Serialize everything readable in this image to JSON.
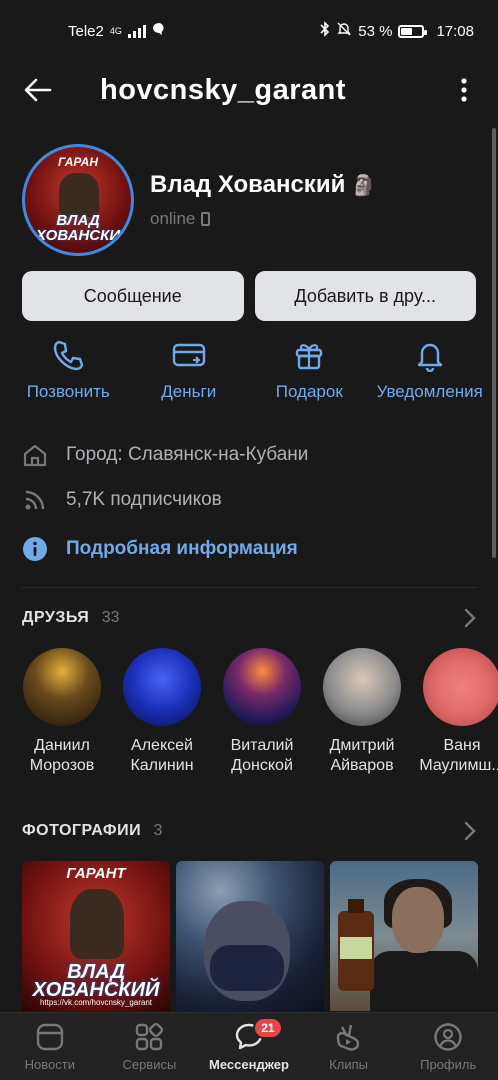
{
  "status_bar": {
    "carrier": "Tele2",
    "network": "4G",
    "battery_percent": "53 %",
    "battery_level": 0.53,
    "time": "17:08"
  },
  "appbar": {
    "title": "hovcnsky_garant",
    "back_icon": "arrow-left-icon",
    "more_icon": "more-vertical-icon"
  },
  "profile": {
    "name": "Влад Хованский",
    "emoji": "🗿",
    "status": "online",
    "avatar_text_top": "ГАРАН",
    "avatar_text_name": "ВЛАД ХОВАНСКИ"
  },
  "buttons": {
    "message": "Сообщение",
    "add_friend": "Добавить в дру..."
  },
  "actions": [
    {
      "label": "Позвонить",
      "icon": "phone-icon"
    },
    {
      "label": "Деньги",
      "icon": "money-icon"
    },
    {
      "label": "Подарок",
      "icon": "gift-icon"
    },
    {
      "label": "Уведомления",
      "icon": "bell-icon"
    }
  ],
  "info": {
    "city": "Город: Славянск-на-Кубани",
    "followers": "5,7K подписчиков",
    "details": "Подробная информация"
  },
  "friends_section": {
    "title": "ДРУЗЬЯ",
    "count": "33",
    "friends": [
      {
        "first": "Даниил",
        "last": "Морозов",
        "color": "#6b4a1c"
      },
      {
        "first": "Алексей",
        "last": "Калинин",
        "color": "#1b2fb8"
      },
      {
        "first": "Виталий",
        "last": "Донской",
        "color": "#241a58"
      },
      {
        "first": "Дмитрий",
        "last": "Айваров",
        "color": "#8c8c8c"
      },
      {
        "first": "Ваня",
        "last": "Маулимш...",
        "color": "#e06a6a"
      }
    ]
  },
  "photos_section": {
    "title": "ФОТОГРАФИИ",
    "count": "3",
    "photo1": {
      "top": "ГАРАНТ",
      "name": "ВЛАД ХОВАНСКИЙ",
      "url": "https://vk.com/hovcnsky_garant"
    }
  },
  "tabbar": {
    "tabs": [
      {
        "label": "Новости",
        "icon": "news-icon"
      },
      {
        "label": "Сервисы",
        "icon": "services-icon"
      },
      {
        "label": "Мессенджер",
        "icon": "messenger-icon",
        "badge": "21"
      },
      {
        "label": "Клипы",
        "icon": "clips-icon"
      },
      {
        "label": "Профиль",
        "icon": "profile-icon"
      }
    ]
  },
  "colors": {
    "background": "#19191a",
    "accent": "#71aaeb",
    "button": "#e1e3e6",
    "badge": "#e64646"
  }
}
